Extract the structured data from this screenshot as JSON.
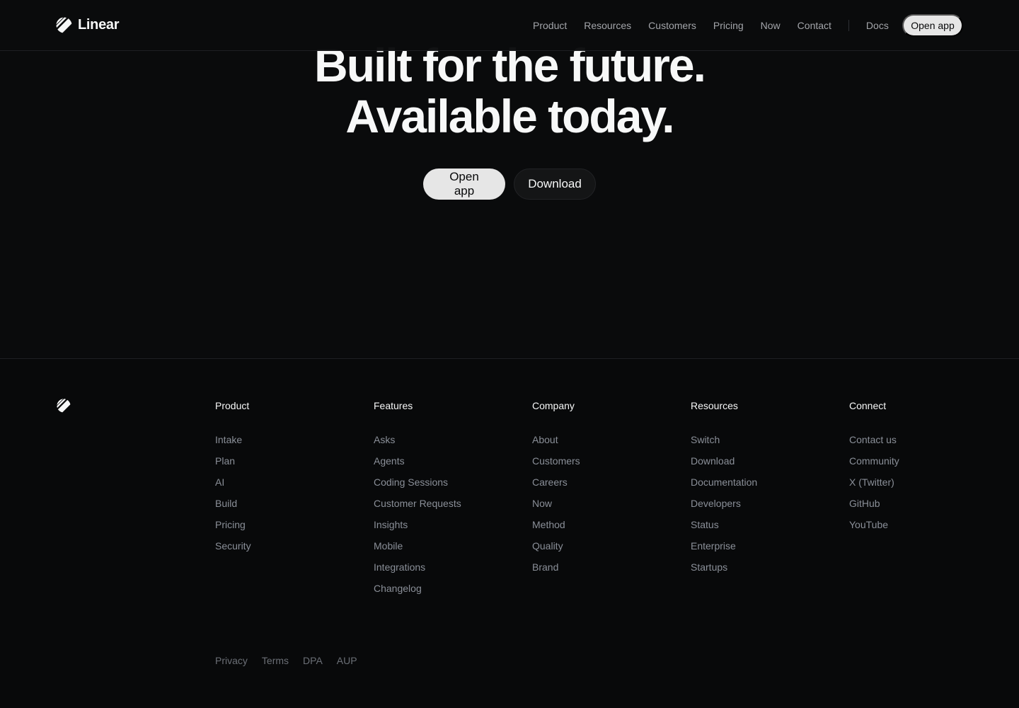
{
  "brand": {
    "name": "Linear"
  },
  "nav": {
    "links": [
      "Product",
      "Resources",
      "Customers",
      "Pricing",
      "Now",
      "Contact"
    ],
    "docs": "Docs",
    "open_app": "Open app"
  },
  "hero": {
    "line1": "Built for the future.",
    "line2": "Available today.",
    "primary_button": "Open app",
    "secondary_button": "Download"
  },
  "footer": {
    "columns": [
      {
        "title": "Product",
        "items": [
          "Intake",
          "Plan",
          "AI",
          "Build",
          "Pricing",
          "Security"
        ]
      },
      {
        "title": "Features",
        "items": [
          "Asks",
          "Agents",
          "Coding Sessions",
          "Customer Requests",
          "Insights",
          "Mobile",
          "Integrations",
          "Changelog"
        ]
      },
      {
        "title": "Company",
        "items": [
          "About",
          "Customers",
          "Careers",
          "Now",
          "Method",
          "Quality",
          "Brand"
        ]
      },
      {
        "title": "Resources",
        "items": [
          "Switch",
          "Download",
          "Documentation",
          "Developers",
          "Status",
          "Enterprise",
          "Startups"
        ]
      },
      {
        "title": "Connect",
        "items": [
          "Contact us",
          "Community",
          "X (Twitter)",
          "GitHub",
          "YouTube"
        ]
      }
    ],
    "legal": [
      "Privacy",
      "Terms",
      "DPA",
      "AUP"
    ]
  },
  "icons": {
    "logo": "linear-logo-icon"
  },
  "colors": {
    "background": "#08090a",
    "text": "#f7f8f8",
    "muted": "#8a8f98",
    "button_light": "#e6e6e6"
  }
}
